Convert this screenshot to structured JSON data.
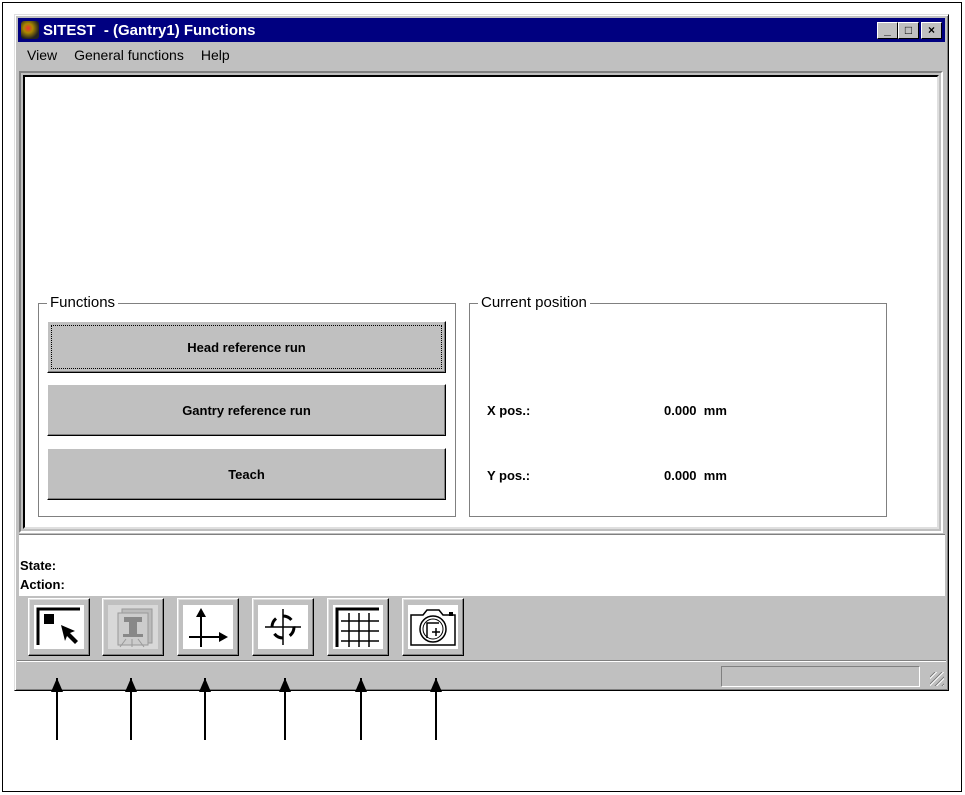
{
  "window": {
    "title": "SITEST  - (Gantry1) Functions",
    "minimize": "_",
    "maximize": "□",
    "close": "×"
  },
  "menu": [
    {
      "label": "View"
    },
    {
      "label": "General functions"
    },
    {
      "label": "Help"
    }
  ],
  "functions": {
    "title": "Functions",
    "buttons": [
      {
        "label": "Head reference run"
      },
      {
        "label": "Gantry reference run"
      },
      {
        "label": "Teach"
      }
    ]
  },
  "position": {
    "title": "Current position",
    "x_label": "X pos.:",
    "x_value": "0.000  mm",
    "y_label": "Y pos.:",
    "y_value": "0.000  mm"
  },
  "status": {
    "state_label": "State:",
    "action_label": "Action:"
  },
  "toolbar": [
    {
      "icon": "select-arrow-icon"
    },
    {
      "icon": "head-icon",
      "disabled": true
    },
    {
      "icon": "axes-icon"
    },
    {
      "icon": "crosshair-icon"
    },
    {
      "icon": "grid-icon"
    },
    {
      "icon": "camera-icon"
    }
  ]
}
